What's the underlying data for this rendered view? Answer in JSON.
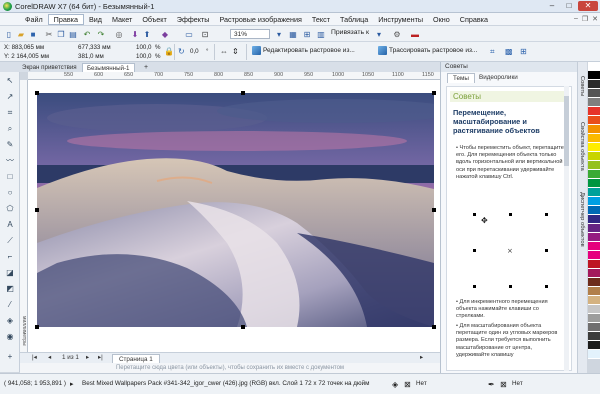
{
  "window": {
    "title": "CorelDRAW X7 (64 бит) - Безымянный-1"
  },
  "menu": [
    "Файл",
    "Правка",
    "Вид",
    "Макет",
    "Объект",
    "Эффекты",
    "Растровые изображения",
    "Текст",
    "Таблица",
    "Инструменты",
    "Окно",
    "Справка"
  ],
  "toolbar": {
    "zoom": "31%",
    "snap_label": "Привязать к"
  },
  "properties": {
    "x": "X: 883,065 мм",
    "y": "Y: 2 164,005 мм",
    "w": "677,333 мм",
    "h": "381,0 мм",
    "sx": "100,0",
    "sy": "100,0",
    "pct1": "%",
    "pct2": "%",
    "angle": "0,0",
    "edit_bitmap": "Редактировать растровое из...",
    "trace_bitmap": "Трассировать растровое из..."
  },
  "doc_tabs": [
    "Экран приветствия",
    "Безымянный-1"
  ],
  "ruler": {
    "h_ticks": [
      "550",
      "600",
      "650",
      "700",
      "750",
      "800",
      "850",
      "900",
      "950",
      "1000",
      "1050",
      "1100",
      "1150"
    ],
    "unit": "миллиметры"
  },
  "docnav": {
    "page_of": "1 из 1",
    "page_tab": "Страница 1"
  },
  "hint": "Перетащите сюда цвета (или объекты), чтобы сохранить их вместе с документом",
  "docker": {
    "header": "Советы",
    "tabs": [
      "Темы",
      "Видеоролики"
    ],
    "tip_header": "Советы",
    "tip_title": "Перемещение, масштабирование и растягивание объектов",
    "tip_p1": "• Чтобы переместить объект, перетащите его. Для перемещения объекта только вдоль горизонтальной или вертикальной оси при перетаскивании удерживайте нажатой клавишу Ctrl.",
    "tip_p2": "• Для инкрементного перемещения объекта нажимайте клавиши со стрелками.",
    "tip_p3": "• Для масштабирования объекта перетащите один из угловых маркеров размера. Если требуется выполнить масштабирование от центра, удерживайте клавишу"
  },
  "side_tabs": [
    "Советы",
    "Свойства объекта",
    "Диспетчер объектов"
  ],
  "status": {
    "coords": "( 941,058; 1 953,891 )",
    "info": "Best Mixed Wallpapers Pack #341-342_igor_cwer (426).jpg (RGB) вкл. Слой 1 72 x 72 точек на дюйм",
    "fill_none": "Нет",
    "outline_none": "Нет"
  },
  "colors": {
    "palette": [
      "#ffffff",
      "#000000",
      "#2b2b2b",
      "#555555",
      "#7f7f7f",
      "#e6332a",
      "#e94e1b",
      "#f39200",
      "#fbba00",
      "#ffed00",
      "#c8d400",
      "#95c11f",
      "#3aaa35",
      "#009640",
      "#00a19a",
      "#009fe3",
      "#0069b4",
      "#312783",
      "#662483",
      "#951b81",
      "#e5007d",
      "#e6007e",
      "#be1622",
      "#a3195b",
      "#6d2c1b",
      "#b17f4a",
      "#d4b280",
      "#c6c6c6",
      "#9d9d9c",
      "#706f6f",
      "#3c3c3b",
      "#1d1d1b",
      "#e3f2fc"
    ]
  }
}
